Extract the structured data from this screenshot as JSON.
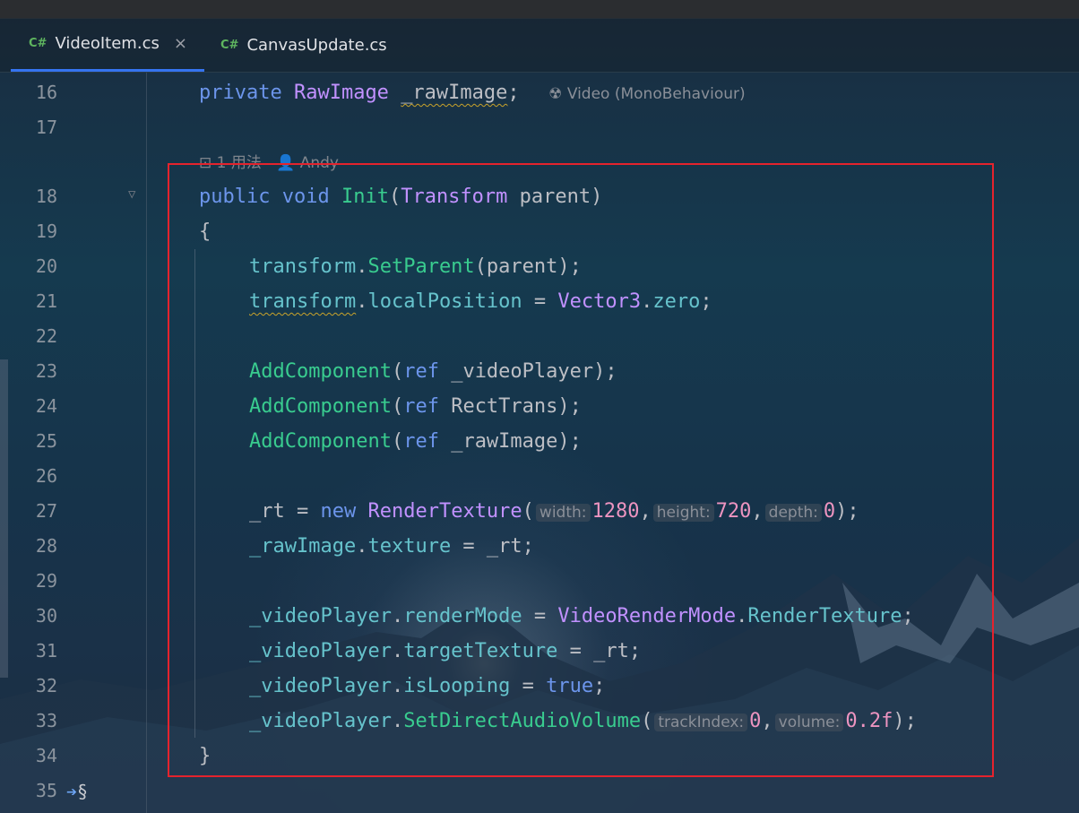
{
  "tabs": [
    {
      "badge": "C#",
      "label": "VideoItem.cs",
      "close": "×"
    },
    {
      "badge": "C#",
      "label": "CanvasUpdate.cs"
    }
  ],
  "topstrip_glyphs": "\u0000",
  "lines": {
    "l16": {
      "num": "16",
      "kw": "private",
      "type": "RawImage",
      "field": "_rawImage",
      "semi": ";"
    },
    "l17": {
      "num": "17"
    },
    "lens18": {
      "usages": "1 用法",
      "author": "Andy"
    },
    "l18": {
      "num": "18",
      "kw1": "public",
      "kw2": "void",
      "fn": "Init",
      "open": "(",
      "type": "Transform",
      "param": " parent",
      "close": ")"
    },
    "l19": {
      "num": "19",
      "text": "{"
    },
    "l20": {
      "num": "20",
      "obj": "transform",
      "dot": ".",
      "fn": "SetParent",
      "args": "(parent);"
    },
    "l21": {
      "num": "21",
      "obj": "transform",
      "dot": ".",
      "mem": "localPosition",
      "eq": " = ",
      "type": "Vector3",
      "dot2": ".",
      "mem2": "zero",
      "semi": ";"
    },
    "l22": {
      "num": "22"
    },
    "l23": {
      "num": "23",
      "fn": "AddComponent",
      "open": "(",
      "kw": "ref",
      "arg": " _videoPlayer",
      "close": ");"
    },
    "l24": {
      "num": "24",
      "fn": "AddComponent",
      "open": "(",
      "kw": "ref",
      "arg": " RectTrans",
      "close": ");"
    },
    "l25": {
      "num": "25",
      "fn": "AddComponent",
      "open": "(",
      "kw": "ref",
      "arg": " _rawImage",
      "close": ");"
    },
    "l26": {
      "num": "26"
    },
    "l27": {
      "num": "27",
      "lhs": "_rt = ",
      "kw": "new",
      "type": " RenderTexture",
      "open": "(",
      "hint1": "width:",
      "n1": "1280",
      "c1": ",",
      "hint2": "height:",
      "n2": "720",
      "c2": ",",
      "hint3": "depth:",
      "n3": "0",
      "close": ");"
    },
    "l28": {
      "num": "28",
      "obj": "_rawImage",
      "dot": ".",
      "mem": "texture",
      "rest": " = _rt;"
    },
    "l29": {
      "num": "29"
    },
    "l30": {
      "num": "30",
      "obj": "_videoPlayer",
      "dot": ".",
      "mem": "renderMode",
      "eq": " = ",
      "type": "VideoRenderMode",
      "dot2": ".",
      "mem2": "RenderTexture",
      "semi": ";"
    },
    "l31": {
      "num": "31",
      "obj": "_videoPlayer",
      "dot": ".",
      "mem": "targetTexture",
      "rest": " = _rt;"
    },
    "l32": {
      "num": "32",
      "obj": "_videoPlayer",
      "dot": ".",
      "mem": "isLooping",
      "eq": " = ",
      "kw": "true",
      "semi": ";"
    },
    "l33": {
      "num": "33",
      "obj": "_videoPlayer",
      "dot": ".",
      "fn": "SetDirectAudioVolume",
      "open": "(",
      "hint1": "trackIndex:",
      "n1": "0",
      "c1": ",",
      "hint2": "volume:",
      "n2": "0.2f",
      "close": ");"
    },
    "l34": {
      "num": "34",
      "text": "}"
    },
    "l35": {
      "num": "35"
    }
  },
  "inlay16": {
    "icon": "☢",
    "text": "Video (MonoBehaviour)"
  },
  "colors": {
    "keyword": "#6c95eb",
    "type": "#c191ff",
    "method": "#39cc8f",
    "member": "#66c3cc",
    "number": "#ed94c0",
    "highlight_border": "#e5232d",
    "tab_active": "#3574f0"
  }
}
